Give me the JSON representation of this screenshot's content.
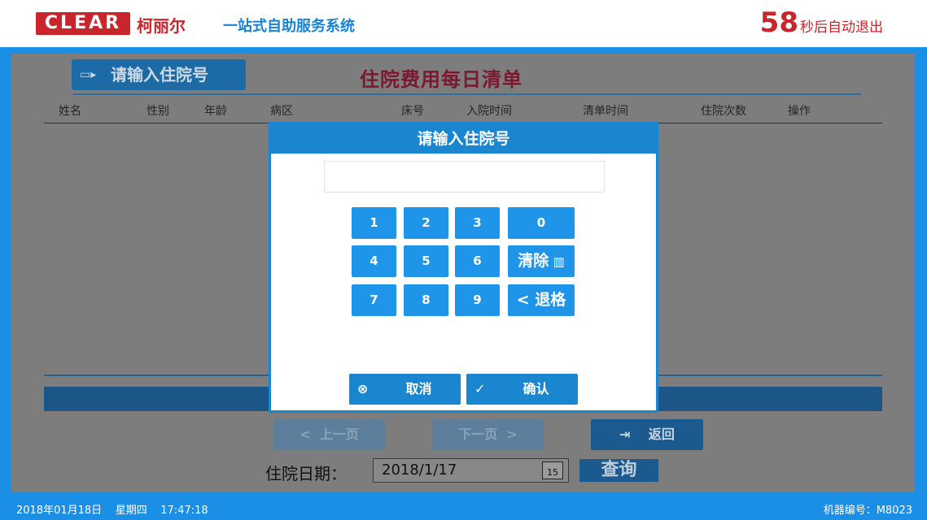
{
  "header": {
    "logo_text": "CLEAR",
    "brand_cn": "柯丽尔",
    "system_name": "一站式自助服务系统",
    "countdown_value": "58",
    "countdown_text": "秒后自动退出"
  },
  "main": {
    "tag_button_label": "请输入住院号",
    "title": "住院费用每日清单",
    "columns": [
      "姓名",
      "性别",
      "年龄",
      "病区",
      "床号",
      "入院时间",
      "清单时间",
      "住院次数",
      "操作"
    ],
    "prev_label": "上一页",
    "next_label": "下一页",
    "back_label": "返回",
    "date_label": "住院日期：",
    "date_value": "2018/1/17",
    "calendar_day": "15",
    "query_label": "查询"
  },
  "modal": {
    "title": "请输入住院号",
    "input_value": "",
    "keys_row1": [
      "1",
      "2",
      "3",
      "0"
    ],
    "keys_row2": [
      "4",
      "5",
      "6"
    ],
    "keys_row3": [
      "7",
      "8",
      "9"
    ],
    "clear_label": "清除",
    "backspace_label": "退格",
    "cancel_label": "取消",
    "confirm_label": "确认"
  },
  "status": {
    "date": "2018年01月18日",
    "weekday": "星期四",
    "time": "17:47:18",
    "machine_label": "机器编号：M8023"
  },
  "colors": {
    "brand_red": "#c8262c",
    "frame_blue": "#1b8ee6",
    "modal_blue": "#1a86cf",
    "key_blue": "#1e95e8",
    "overlay_gray": "#7d7d7d"
  }
}
